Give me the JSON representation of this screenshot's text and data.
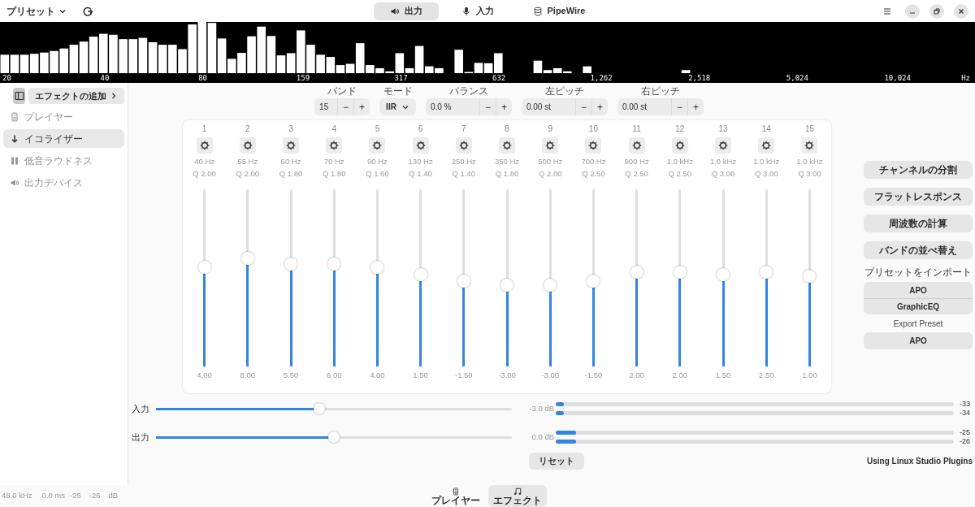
{
  "header": {
    "preset_menu": "プリセット",
    "tabs": [
      {
        "label": "出力",
        "selected": true
      },
      {
        "label": "入力",
        "selected": false
      },
      {
        "label": "PipeWire",
        "selected": false
      }
    ]
  },
  "spectrum": {
    "x_labels": [
      "20",
      "40",
      "80",
      "159",
      "317",
      "632",
      "1,262",
      "2,518",
      "5,024",
      "10,024"
    ],
    "unit": "Hz"
  },
  "sidebar": {
    "add_effect": "エフェクトの追加",
    "items": [
      {
        "label": "プレイヤー",
        "selected": false,
        "disabled": true
      },
      {
        "label": "イコライザー",
        "selected": true,
        "disabled": false
      },
      {
        "label": "低音ラウドネス",
        "selected": false,
        "disabled": true
      },
      {
        "label": "出力デバイス",
        "selected": false,
        "disabled": true
      }
    ]
  },
  "controls": [
    {
      "label": "バンド",
      "value": "15",
      "kind": "spin"
    },
    {
      "label": "モード",
      "value": "IIR",
      "kind": "dropdown"
    },
    {
      "label": "バランス",
      "value": "0.0 %",
      "kind": "spin"
    },
    {
      "label": "左ピッチ",
      "value": "0.00 st",
      "kind": "spin"
    },
    {
      "label": "右ピッチ",
      "value": "0.00 st",
      "kind": "spin"
    }
  ],
  "spin_signs": {
    "minus": "−",
    "plus": "+"
  },
  "bands": [
    {
      "number": "1",
      "frequency": "40 Hz",
      "q": "Q 2.00",
      "level": 0.56,
      "gain": "4.00"
    },
    {
      "number": "2",
      "frequency": "55 Hz",
      "q": "Q 2.00",
      "level": 0.61,
      "gain": "8.00"
    },
    {
      "number": "3",
      "frequency": "60 Hz",
      "q": "Q 1.80",
      "level": 0.58,
      "gain": "5.50"
    },
    {
      "number": "4",
      "frequency": "70 Hz",
      "q": "Q 1.80",
      "level": 0.58,
      "gain": "6.00"
    },
    {
      "number": "5",
      "frequency": "90 Hz",
      "q": "Q 1.60",
      "level": 0.56,
      "gain": "4.00"
    },
    {
      "number": "6",
      "frequency": "130 Hz",
      "q": "Q 1.40",
      "level": 0.52,
      "gain": "1.50"
    },
    {
      "number": "7",
      "frequency": "250 Hz",
      "q": "Q 1.40",
      "level": 0.48,
      "gain": "-1.50"
    },
    {
      "number": "8",
      "frequency": "350 Hz",
      "q": "Q 1.80",
      "level": 0.46,
      "gain": "-3.00"
    },
    {
      "number": "9",
      "frequency": "500 Hz",
      "q": "Q 2.00",
      "level": 0.46,
      "gain": "-3.00"
    },
    {
      "number": "10",
      "frequency": "700 Hz",
      "q": "Q 2.50",
      "level": 0.48,
      "gain": "-1.50"
    },
    {
      "number": "11",
      "frequency": "900 Hz",
      "q": "Q 2.50",
      "level": 0.53,
      "gain": "2.00"
    },
    {
      "number": "12",
      "frequency": "1.0 kHz",
      "q": "Q 2.50",
      "level": 0.53,
      "gain": "2.00"
    },
    {
      "number": "13",
      "frequency": "1.0 kHz",
      "q": "Q 3.00",
      "level": 0.52,
      "gain": "1.50"
    },
    {
      "number": "14",
      "frequency": "1.0 kHz",
      "q": "Q 3.00",
      "level": 0.53,
      "gain": "2.50"
    },
    {
      "number": "15",
      "frequency": "1.0 kHz",
      "q": "Q 3.00",
      "level": 0.51,
      "gain": "1.00"
    }
  ],
  "actions": [
    "チャンネルの分割",
    "フラットレスポンス",
    "周波数の計算",
    "バンドの並べ替え"
  ],
  "import_preset": {
    "label": "プリセットをインポート",
    "buttons": [
      "APO",
      "GraphicEQ"
    ]
  },
  "export_preset": {
    "label": "Export Preset",
    "buttons": [
      "APO"
    ]
  },
  "gains": [
    {
      "label": "入力",
      "level": 0.46,
      "reading": "-3.0 dB",
      "meters": [
        {
          "level": 0.02,
          "reading": "-33"
        },
        {
          "level": 0.02,
          "reading": "-34"
        }
      ]
    },
    {
      "label": "出力",
      "level": 0.5,
      "reading": "0.0 dB",
      "meters": [
        {
          "level": 0.05,
          "reading": "-25"
        },
        {
          "level": 0.05,
          "reading": "-26"
        }
      ]
    }
  ],
  "reset": "リセット",
  "plugins_note": "Using Linux Studio Plugins",
  "status": [
    "48.0 kHz",
    "0.0 ms",
    "-25",
    "-26",
    "dB"
  ],
  "bottom_tabs": [
    {
      "label": "プレイヤー",
      "selected": false
    },
    {
      "label": "エフェクト",
      "selected": true
    }
  ]
}
